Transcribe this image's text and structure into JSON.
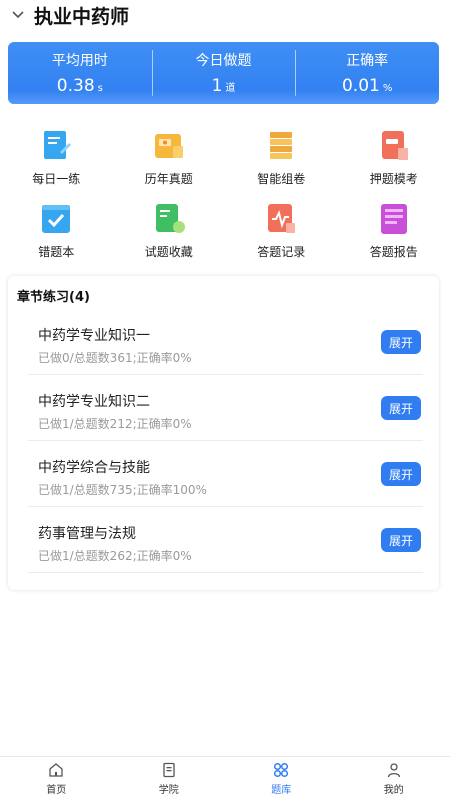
{
  "header": {
    "title": "执业中药师"
  },
  "stats": [
    {
      "label": "平均用时",
      "value": "0.38",
      "unit": "s"
    },
    {
      "label": "今日做题",
      "value": "1",
      "unit": "道"
    },
    {
      "label": "正确率",
      "value": "0.01",
      "unit": "%"
    }
  ],
  "grid": [
    {
      "label": "每日一练",
      "icon": "daily-practice-icon"
    },
    {
      "label": "历年真题",
      "icon": "past-exams-icon"
    },
    {
      "label": "智能组卷",
      "icon": "smart-paper-icon"
    },
    {
      "label": "押题模考",
      "icon": "mock-exam-icon"
    },
    {
      "label": "错题本",
      "icon": "wrong-questions-icon"
    },
    {
      "label": "试题收藏",
      "icon": "favorites-icon"
    },
    {
      "label": "答题记录",
      "icon": "answer-record-icon"
    },
    {
      "label": "答题报告",
      "icon": "answer-report-icon"
    }
  ],
  "chapters": {
    "title": "章节练习(4)",
    "expand_label": "展开",
    "items": [
      {
        "name": "中药学专业知识一",
        "sub": "已做0/总题数361;正确率0%"
      },
      {
        "name": "中药学专业知识二",
        "sub": "已做1/总题数212;正确率0%"
      },
      {
        "name": "中药学综合与技能",
        "sub": "已做1/总题数735;正确率100%"
      },
      {
        "name": "药事管理与法规",
        "sub": "已做1/总题数262;正确率0%"
      }
    ]
  },
  "tabs": [
    {
      "label": "首页",
      "icon": "home-icon"
    },
    {
      "label": "学院",
      "icon": "academy-icon"
    },
    {
      "label": "题库",
      "icon": "question-bank-icon"
    },
    {
      "label": "我的",
      "icon": "profile-icon"
    }
  ],
  "colors": {
    "accent": "#2f7df0"
  }
}
